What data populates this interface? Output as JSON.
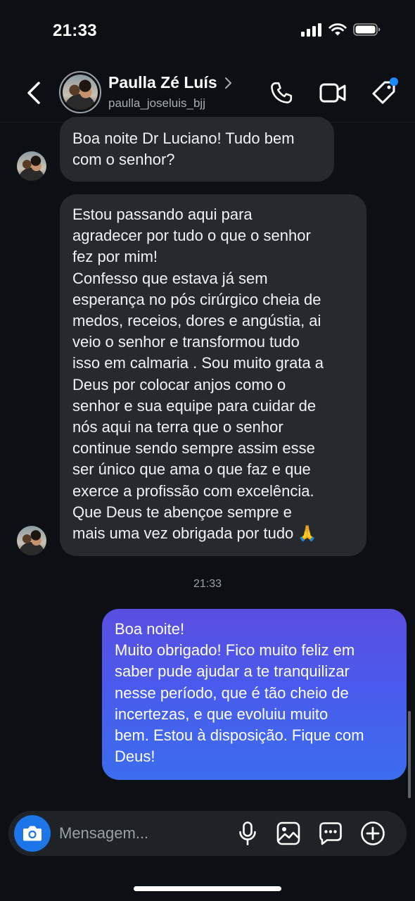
{
  "status_bar": {
    "time": "21:33"
  },
  "header": {
    "contact_name": "Paulla Zé Luís",
    "username": "paulla_joseluis_bjj"
  },
  "icons": {
    "back": "chevron-left-icon",
    "profile_arrow": "chevron-right-icon",
    "call": "phone-icon",
    "video": "video-camera-icon",
    "tag": "tag-icon",
    "camera": "camera-icon",
    "mic": "microphone-icon",
    "gallery": "image-icon",
    "sticker": "chat-bubble-icon",
    "add": "plus-circle-icon"
  },
  "messages": [
    {
      "sender": "Paulla Zé Luís",
      "direction": "incoming",
      "lines": [
        "Boa noite Dr Luciano! Tudo bem",
        "com o senhor?"
      ]
    },
    {
      "sender": "Paulla Zé Luís",
      "direction": "incoming",
      "lines": [
        "Estou passando aqui para",
        "agradecer por tudo o que o senhor",
        "fez por mim!",
        "Confesso que estava já sem",
        "esperança no pós cirúrgico cheia de",
        "medos, receios, dores e angústia, ai",
        "veio o senhor e transformou tudo",
        "isso em calmaria . Sou muito grata a",
        "Deus por colocar anjos como o",
        "senhor e sua equipe  para cuidar de",
        "nós aqui na terra que o senhor",
        "continue sendo sempre assim esse",
        "ser único que ama o que faz e que",
        "exerce a profissão com excelência.",
        "Que Deus te abençoe sempre e",
        "mais uma vez obrigada por tudo 🙏"
      ]
    },
    {
      "direction": "outgoing",
      "lines": [
        "Boa noite!",
        "Muito obrigado! Fico muito feliz em",
        "saber pude ajudar a te tranquilizar",
        "nesse período, que é tão cheio de",
        "incertezas, e que evoluiu muito",
        "bem. Estou à disposição. Fique com",
        "Deus!"
      ]
    }
  ],
  "timestamp": "21:33",
  "composer": {
    "placeholder": "Mensagem..."
  },
  "colors": {
    "background": "#0c1014",
    "incoming_bubble": "#262a2f",
    "outgoing_bubble_top": "#5a4ee0",
    "outgoing_bubble_bottom": "#3b6ded",
    "camera_button": "#1d76e8",
    "notification_dot": "#1a8cff"
  }
}
